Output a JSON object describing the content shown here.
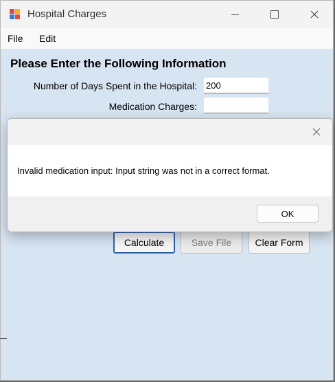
{
  "window": {
    "title": "Hospital Charges",
    "controls": {
      "minimize": "—",
      "maximize": "□",
      "close": "✕"
    }
  },
  "menu": {
    "items": [
      "File",
      "Edit"
    ]
  },
  "form": {
    "heading": "Please Enter the Following Information",
    "days_label": "Number of Days Spent in the Hospital:",
    "days_value": "200",
    "medication_label": "Medication Charges:",
    "medication_value": ""
  },
  "buttons": {
    "calculate": "Calculate",
    "save": "Save File",
    "clear": "Clear Form"
  },
  "dialog": {
    "message": "Invalid medication input: Input string was not in a correct format.",
    "ok": "OK"
  },
  "colors": {
    "form_bg": "#d7e4f1",
    "titlebar_bg": "#f3f3f3",
    "primary_border": "#2f5fa8"
  }
}
